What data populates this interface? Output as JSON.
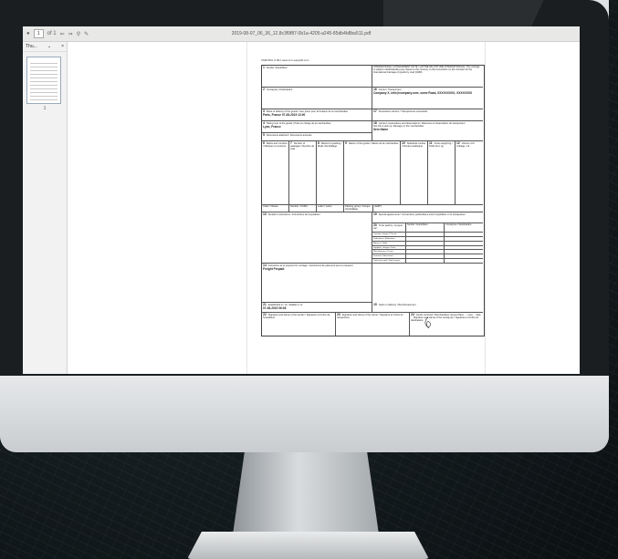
{
  "window": {
    "title": "2019-08-07_06_36_12.8c3f9f87-0b1a-4205-a245-85db4b8ba511.pdf",
    "page_current": "1",
    "page_total": "of 1"
  },
  "sidebar": {
    "label": "Thu...",
    "thumb_page": "1"
  },
  "doc": {
    "header": "CMR BOL # 001   www.cmr-easybill.com",
    "c1": "Sender / Expéditeur",
    "c1r": "INTERNATIONAL CONSIGNMENT NOTE / LETTRE DE VOITURE INTERNATIONALE. This carriage is subject notwithstanding any clause to the contrary, to the Convention on the Contract for the International Carriage of goods by road (CMR).",
    "c2": "Consignee / Destinataire",
    "c16": "Carrier / Transporteur",
    "c16v": "Company X, info@company.com, some Road, XXXXXXXXX, XXXXXXXX",
    "c3": "Place of delivery of the goods / Lieu prévu pour la livraison de la marchandise",
    "c3v": "Paris, France   07-08-2019 13:00",
    "c17": "Successive carriers / Transporteurs successifs",
    "c4": "Taking over of the goods / Prise en charge de la marchandise",
    "c4v": "Lyon, France",
    "c18": "Carrier's reservations and observations / Réserves et observations du transporteur",
    "c18v": "Not OK to pick up. Damage on the merchandise",
    "c18w": "Item Name",
    "c5": "Documents attached / Documents annexés",
    "g6": "Marks and numbers / Marques et numéros",
    "g7": "Number of packages / Nombre de colis",
    "g8": "Method of packing / Mode d'emballage",
    "g9": "Nature of the goods / Nature de la marchandise",
    "g10": "Statistical number / Numéro statistique",
    "g11": "Gross weight kg / Poids brut, kg",
    "g12": "Volume m3 / Cubage, m3",
    "r_un": "Class / Classe",
    "r_num": "Number / Chiffre",
    "r_let": "Letter / Lettre",
    "r_adr": "(ADR*)",
    "r_pg": "Packing group / Groupe d'emballage",
    "c13": "Sender's instructions / Instructions de l'expéditeur",
    "c19": "Special agreements / Conventions particulières entre l'expéditeur et le transporteur",
    "c20": "To be paid by / A payer par",
    "c20s": "Sender / Expéditeur",
    "c20c": "Consignee / Destinataire",
    "pay": [
      "Carriage charges / Prix de transport",
      "Deductions / Réductions",
      "Balance / Solde",
      "Supplem. charges / Frais accessoires",
      "Miscellaneous / Divers",
      "Insurance / Assurance",
      "Total to be paid / Total à payer"
    ],
    "c14": "Instruction as to payment for carriage / Instructions de paiement pour le transport",
    "c14v": "Freight Prepaid",
    "c21": "Established in / on / Etablie à / le",
    "c21v": "07-08-2019 06:36",
    "c15": "Cash on delivery / Remboursement",
    "c22": "Signature and stamp of the sender / Signature et timbre de l'expéditeur",
    "c23": "Signature and stamp of the carrier / Signature et timbre du transporteur",
    "c24": "Goods received / Marchandises reçues   Place ... / Lieu ... date ...  Signature and stamp of the consignee / Signature et timbre du destinataire"
  }
}
